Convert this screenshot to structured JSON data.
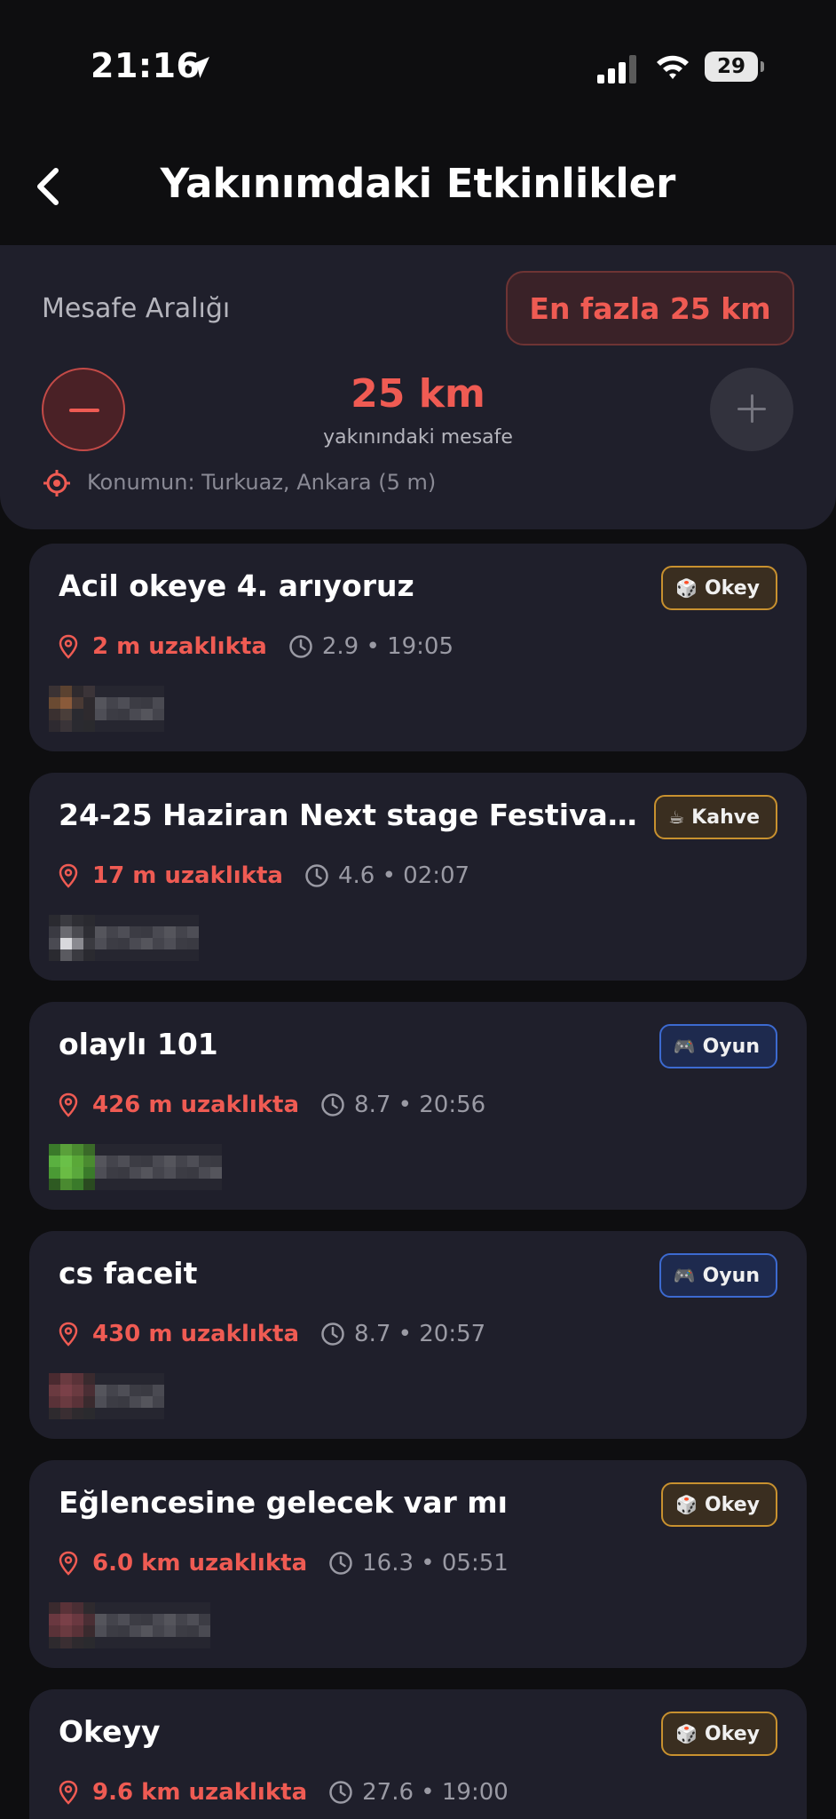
{
  "status_bar": {
    "time": "21:16",
    "battery": "29"
  },
  "header": {
    "title": "Yakınımdaki Etkinlikler"
  },
  "range": {
    "label": "Mesafe Aralığı",
    "max_badge": "En fazla 25 km",
    "value": "25 km",
    "caption": "yakınındaki mesafe",
    "location": "Konumun: Turkuaz, Ankara (5 m)"
  },
  "events": [
    {
      "title": "Acil okeye 4. arıyoruz",
      "category": "Okey",
      "category_icon": "🎲",
      "category_style": "okey",
      "distance": "2 m uzaklıkta",
      "rating_time": "2.9 • 19:05"
    },
    {
      "title": "24-25 Haziran Next stage Festivali…",
      "category": "Kahve",
      "category_icon": "☕",
      "category_style": "kahve",
      "distance": "17 m uzaklıkta",
      "rating_time": "4.6 • 02:07"
    },
    {
      "title": "olaylı 101",
      "category": "Oyun",
      "category_icon": "🎮",
      "category_style": "oyun",
      "distance": "426 m uzaklıkta",
      "rating_time": "8.7 • 20:56"
    },
    {
      "title": "cs faceit",
      "category": "Oyun",
      "category_icon": "🎮",
      "category_style": "oyun",
      "distance": "430 m uzaklıkta",
      "rating_time": "8.7 • 20:57"
    },
    {
      "title": "Eğlencesine gelecek var mı",
      "category": "Okey",
      "category_icon": "🎲",
      "category_style": "okey",
      "distance": "6.0 km uzaklıkta",
      "rating_time": "16.3 • 05:51"
    },
    {
      "title": "Okeyy",
      "category": "Okey",
      "category_icon": "🎲",
      "category_style": "okey",
      "distance": "9.6 km uzaklıkta",
      "rating_time": "27.6 • 19:00"
    }
  ],
  "colors": {
    "accent": "#ef5b53",
    "card": "#1f1f2b",
    "background": "#0e0e10"
  }
}
